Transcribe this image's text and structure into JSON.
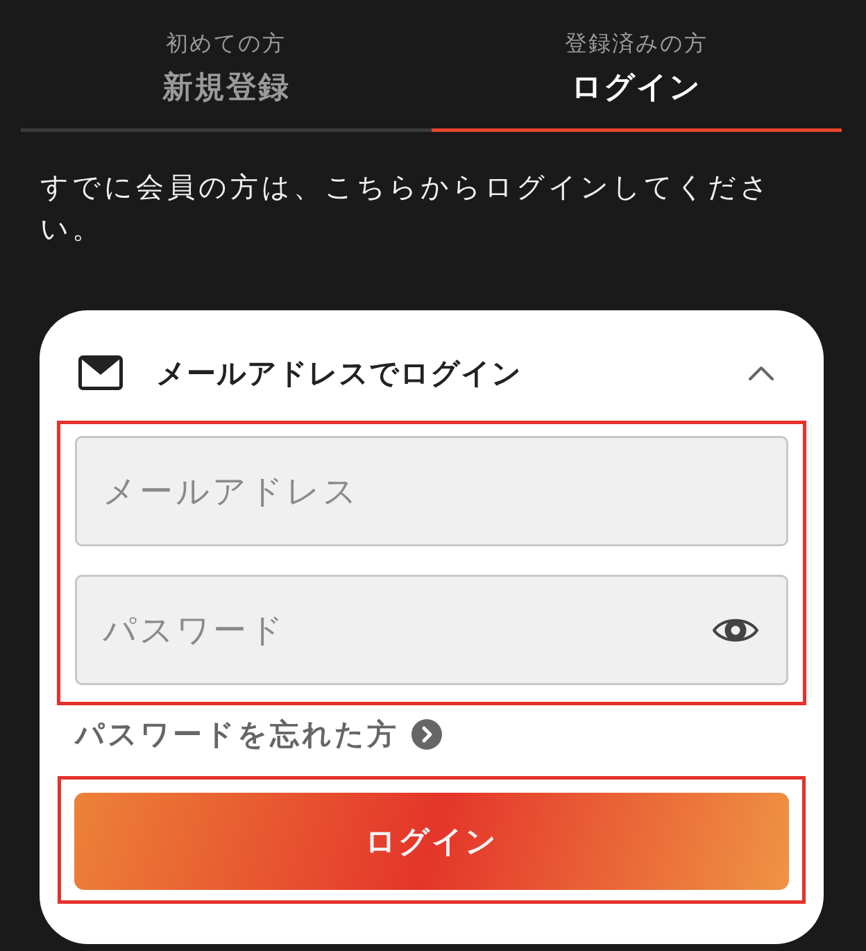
{
  "tabs": [
    {
      "subtitle": "初めての方",
      "label": "新規登録",
      "selected": false
    },
    {
      "subtitle": "登録済みの方",
      "label": "ログイン",
      "selected": true
    }
  ],
  "intro": "すでに会員の方は、こちらからログインしてください。",
  "login_panel": {
    "title": "メールアドレスでログイン",
    "expanded": true,
    "fields": {
      "highlighted": true,
      "items": [
        {
          "kind": "email",
          "placeholder": "メールアドレス"
        },
        {
          "kind": "password",
          "placeholder": "パスワード"
        }
      ]
    },
    "forgot_link": "パスワードを忘れた方",
    "submit": {
      "label": "ログイン",
      "highlighted": true
    }
  }
}
